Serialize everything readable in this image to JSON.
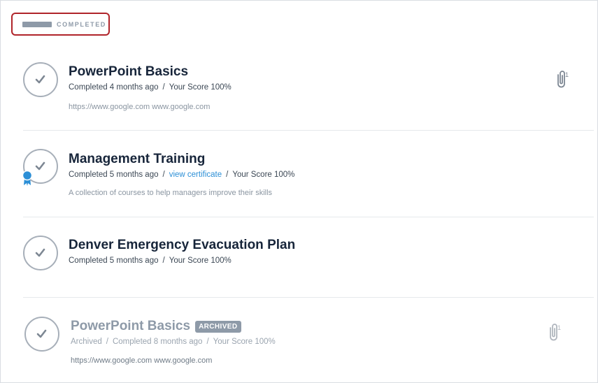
{
  "section": {
    "label": "COMPLETED"
  },
  "items": [
    {
      "title": "PowerPoint Basics",
      "completed": "Completed 4 months ago",
      "score": "Your Score 100%",
      "description": "https://www.google.com www.google.com",
      "attachments": "1"
    },
    {
      "title": "Management Training",
      "completed": "Completed 5 months ago",
      "certificate_link": "view certificate",
      "score": "Your Score 100%",
      "description": "A collection of courses to help managers improve their skills"
    },
    {
      "title": "Denver Emergency Evacuation Plan",
      "completed": "Completed 5 months ago",
      "score": "Your Score 100%"
    },
    {
      "title": "PowerPoint Basics",
      "badge": "ARCHIVED",
      "archived": "Archived",
      "completed": "Completed 8 months ago",
      "score": "Your Score 100%",
      "description": "https://www.google.com www.google.com",
      "attachments": "1"
    }
  ],
  "separator": "/",
  "colors": {
    "accent": "#2c8fd6",
    "highlight_border": "#b0242a",
    "badge": "#8e9aa8"
  }
}
